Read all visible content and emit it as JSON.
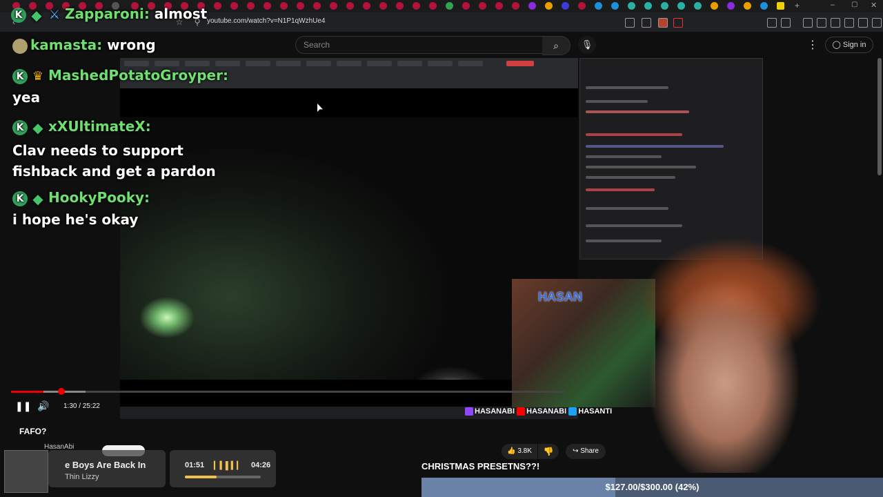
{
  "browser": {
    "url": "youtube.com/watch?v=N1P1qWzhUe4"
  },
  "youtube": {
    "search_placeholder": "Search",
    "signin_label": "Sign in",
    "video_title": "FAFO?",
    "channel_name": "HasanAbi",
    "like_count": "3.8K",
    "share_label": "Share",
    "time_display": "1:30 / 25:22",
    "progress_fraction": 0.059
  },
  "chat": {
    "messages": [
      {
        "user": "Zapparoni:",
        "text": "almost",
        "badges": [
          "sub",
          "diamond",
          "sword"
        ]
      },
      {
        "user": "kamasta:",
        "text": "wrong",
        "badges": [
          "avatar"
        ]
      },
      {
        "user": "MashedPotatoGroyper:",
        "text": "yea",
        "badges": [
          "sub",
          "crown"
        ]
      },
      {
        "user": "xXUltimateX:",
        "text": "Clav needs to support fishback and get a pardon",
        "badges": [
          "sub",
          "diamond"
        ]
      },
      {
        "user": "HookyPooky:",
        "text": "i hope he's okay",
        "badges": [
          "sub",
          "diamond"
        ]
      }
    ]
  },
  "music": {
    "song": "e Boys Are Back In",
    "artist": "Thin Lizzy",
    "elapsed": "01:51",
    "duration": "04:26",
    "progress_fraction": 0.42
  },
  "goal": {
    "title": "CHRISTMAS PRESETNS??!",
    "text": "$127.00/$300.00 (42%)",
    "fraction": 0.42
  },
  "stream_overlay": {
    "cam_logo": "HASAN",
    "socials": [
      "HASANABI",
      "HASANABI",
      "HASANTI"
    ]
  },
  "colors": {
    "youtube_red": "#ff0000",
    "chat_name_green": "#6fe06f",
    "goal_bar": "#6a82a8"
  }
}
